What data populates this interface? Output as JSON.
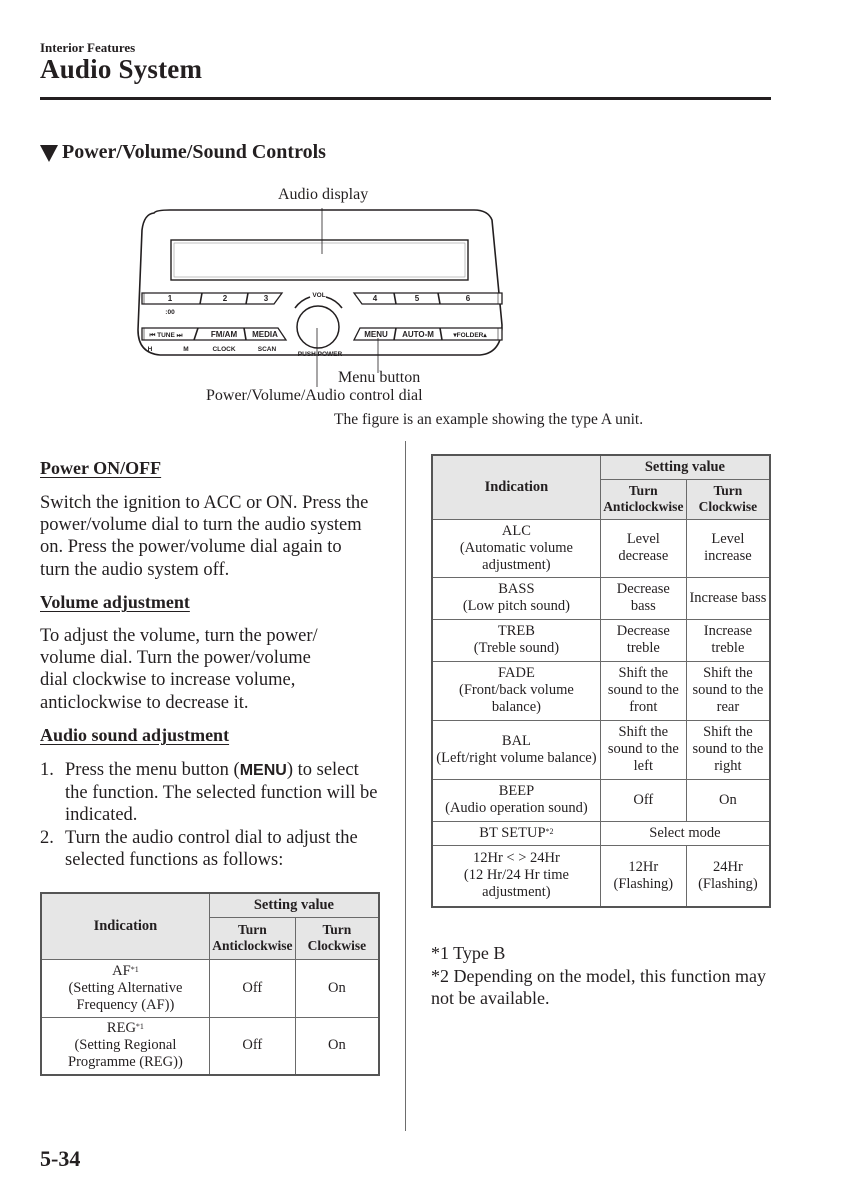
{
  "header": {
    "section": "Interior Features",
    "title": "Audio System"
  },
  "subsection_title": "Power/Volume/Sound Controls",
  "diagram": {
    "callouts": {
      "audio_display": "Audio display",
      "menu_button": "Menu button",
      "dial": "Power/Volume/Audio control dial"
    },
    "buttons": {
      "preset_1": "1",
      "preset_1_sub": ":00",
      "preset_2": "2",
      "preset_3": "3",
      "preset_4": "4",
      "preset_5": "5",
      "preset_6": "6",
      "tune": "⏮ TUNE ⏭",
      "tune_sub_h": "H",
      "tune_sub_m": "M",
      "fmam": "FM/AM",
      "fmam_sub": "CLOCK",
      "media": "MEDIA",
      "media_sub": "SCAN",
      "menu": "MENU",
      "autom": "AUTO-M",
      "folder": "▾FOLDER▴",
      "vol": "VOL",
      "push_power": "PUSH POWER"
    },
    "caption": "The figure is an example showing the type A unit."
  },
  "left_column": {
    "power": {
      "heading": "Power ON/OFF",
      "text": "Switch the ignition to ACC or ON. Press the power/volume dial to turn the audio system on. Press the power/volume dial again to turn the audio system off."
    },
    "volume": {
      "heading": "Volume adjustment",
      "text": "To adjust the volume, turn the power/ volume dial. Turn the power/volume dial clockwise to increase volume, anticlockwise to decrease it."
    },
    "sound": {
      "heading": "Audio sound adjustment",
      "steps": [
        {
          "num": "1.",
          "pre": "Press the menu button (",
          "kw": "MENU",
          "post": ") to select the function. The selected function will be indicated."
        },
        {
          "num": "2.",
          "pre": "Turn the audio control dial to adjust the selected functions as follows:",
          "kw": "",
          "post": ""
        }
      ]
    }
  },
  "table_headers": {
    "indication": "Indication",
    "setting_value": "Setting value",
    "anticlockwise": "Turn Anticlockwise",
    "clockwise": "Turn Clockwise"
  },
  "table_left": [
    {
      "name": "AF",
      "sup": "*1",
      "desc": "(Setting Alternative Frequency (AF))",
      "anti": "Off",
      "clock": "On"
    },
    {
      "name": "REG",
      "sup": "*1",
      "desc": "(Setting Regional Programme (REG))",
      "anti": "Off",
      "clock": "On"
    }
  ],
  "table_right": [
    {
      "name": "ALC",
      "sup": "",
      "desc": "(Automatic volume adjustment)",
      "anti": "Level decrease",
      "clock": "Level increase"
    },
    {
      "name": "BASS",
      "sup": "",
      "desc": "(Low pitch sound)",
      "anti": "Decrease bass",
      "clock": "Increase bass"
    },
    {
      "name": "TREB",
      "sup": "",
      "desc": "(Treble sound)",
      "anti": "Decrease treble",
      "clock": "Increase treble"
    },
    {
      "name": "FADE",
      "sup": "",
      "desc": "(Front/back volume balance)",
      "anti": "Shift the sound to the front",
      "clock": "Shift the sound to the rear"
    },
    {
      "name": "BAL",
      "sup": "",
      "desc": "(Left/right volume balance)",
      "anti": "Shift the sound to the left",
      "clock": "Shift the sound to the right"
    },
    {
      "name": "BEEP",
      "sup": "",
      "desc": "(Audio operation sound)",
      "anti": "Off",
      "clock": "On"
    },
    {
      "name": "BT SETUP",
      "sup": "*2",
      "desc": "",
      "merged": "Select mode"
    },
    {
      "name": "12Hr < > 24Hr",
      "sup": "",
      "desc": "(12 Hr/24 Hr time adjustment)",
      "anti": "12Hr (Flashing)",
      "clock": "24Hr (Flashing)"
    }
  ],
  "footnotes": [
    "*1 Type B",
    "*2 Depending on the model, this function may not be available."
  ],
  "page_number": "5-34"
}
